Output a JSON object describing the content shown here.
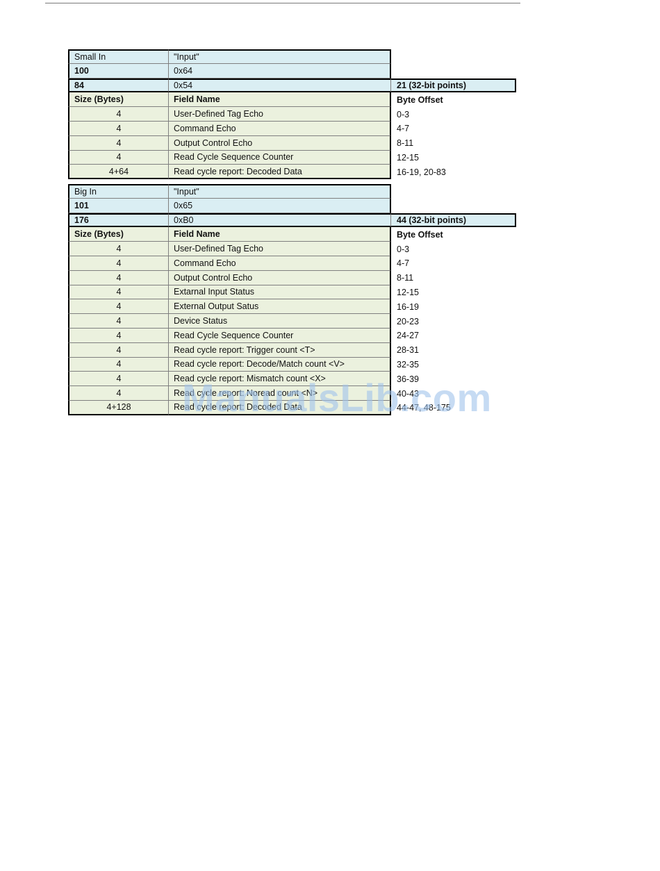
{
  "small_in": {
    "name": "Small In",
    "type": "\"Input\"",
    "instance_dec": "100",
    "instance_hex": "0x64",
    "size_dec": "84",
    "size_hex": "0x54",
    "points": "21 (32-bit points)",
    "headers": {
      "size": "Size (Bytes)",
      "field": "Field Name",
      "offset": "Byte Offset"
    },
    "rows": [
      {
        "size": "4",
        "field": "User-Defined Tag Echo",
        "offset": "0-3"
      },
      {
        "size": "4",
        "field": "Command Echo",
        "offset": "4-7"
      },
      {
        "size": "4",
        "field": "Output Control  Echo",
        "offset": "8-11"
      },
      {
        "size": "4",
        "field": "Read Cycle Sequence Counter",
        "offset": "12-15"
      },
      {
        "size": "4+64",
        "field": "Read cycle  report: Decoded Data",
        "offset": "16-19,  20-83"
      }
    ]
  },
  "big_in": {
    "name": "Big In",
    "type": "\"Input\"",
    "instance_dec": "101",
    "instance_hex": "0x65",
    "size_dec": "176",
    "size_hex": "0xB0",
    "points": "44 (32-bit points)",
    "headers": {
      "size": "Size (Bytes)",
      "field": "Field Name",
      "offset": "Byte Offset"
    },
    "rows": [
      {
        "size": "4",
        "field": "User-Defined Tag Echo",
        "offset": "0-3"
      },
      {
        "size": "4",
        "field": "Command Echo",
        "offset": "4-7"
      },
      {
        "size": "4",
        "field": "Output Control  Echo",
        "offset": "8-11"
      },
      {
        "size": "4",
        "field": "Extarnal Input Status",
        "offset": "12-15"
      },
      {
        "size": "4",
        "field": "External Output Satus",
        "offset": "16-19"
      },
      {
        "size": "4",
        "field": "Device Status",
        "offset": "20-23"
      },
      {
        "size": "4",
        "field": "Read Cycle Sequence Counter",
        "offset": "24-27"
      },
      {
        "size": "4",
        "field": "Read cycle  report: Trigger  count <T>",
        "offset": "28-31"
      },
      {
        "size": "4",
        "field": "Read cycle  report: Decode/Match  count <V>",
        "offset": "32-35"
      },
      {
        "size": "4",
        "field": "Read cycle  report: Mismatch  count <X>",
        "offset": "36-39"
      },
      {
        "size": "4",
        "field": "Read cycle  report: Noread count <N>",
        "offset": "40-43"
      },
      {
        "size": "4+128",
        "field": "Read cycle  report: Decoded Data",
        "offset": "44-47,  48-175"
      }
    ]
  },
  "watermark": "ManualsLib.com"
}
